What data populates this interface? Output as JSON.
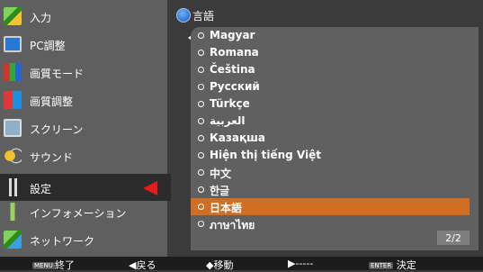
{
  "left_menu": {
    "items": [
      {
        "label": "入力",
        "icon": "input-icon"
      },
      {
        "label": "PC調整",
        "icon": "pc-adjust-icon"
      },
      {
        "label": "画質モード",
        "icon": "image-mode-icon"
      },
      {
        "label": "画質調整",
        "icon": "image-adjust-icon"
      },
      {
        "label": "スクリーン",
        "icon": "screen-icon"
      },
      {
        "label": "サウンド",
        "icon": "sound-icon"
      },
      {
        "label": "設定",
        "icon": "settings-icon"
      },
      {
        "label": "インフォメーション",
        "icon": "information-icon"
      },
      {
        "label": "ネットワーク",
        "icon": "network-icon"
      }
    ],
    "selected_label": "設定"
  },
  "panel": {
    "title": "言語",
    "icon": "globe-icon",
    "languages": [
      "Magyar",
      "Romana",
      "Čeština",
      "Русский",
      "Türkçe",
      "العربية",
      "Казақша",
      "Hiện thị tiếng Việt",
      "中文",
      "한글",
      "日本語",
      "ภาษาไทย"
    ],
    "selected_language": "日本語",
    "page_indicator": "2/2"
  },
  "footer": {
    "menu_key": "MENU",
    "back_label": "終了",
    "back_arrow": "◀戻る",
    "move_label": "◆移動",
    "right_label": "▶-----",
    "enter_key": "ENTER",
    "enter_label": "決定"
  },
  "colors": {
    "accent_orange": "#d06f24",
    "selection_arrow_red": "#e41c1c",
    "menu_bg": "#5f5f5f",
    "list_bg": "#606060"
  }
}
